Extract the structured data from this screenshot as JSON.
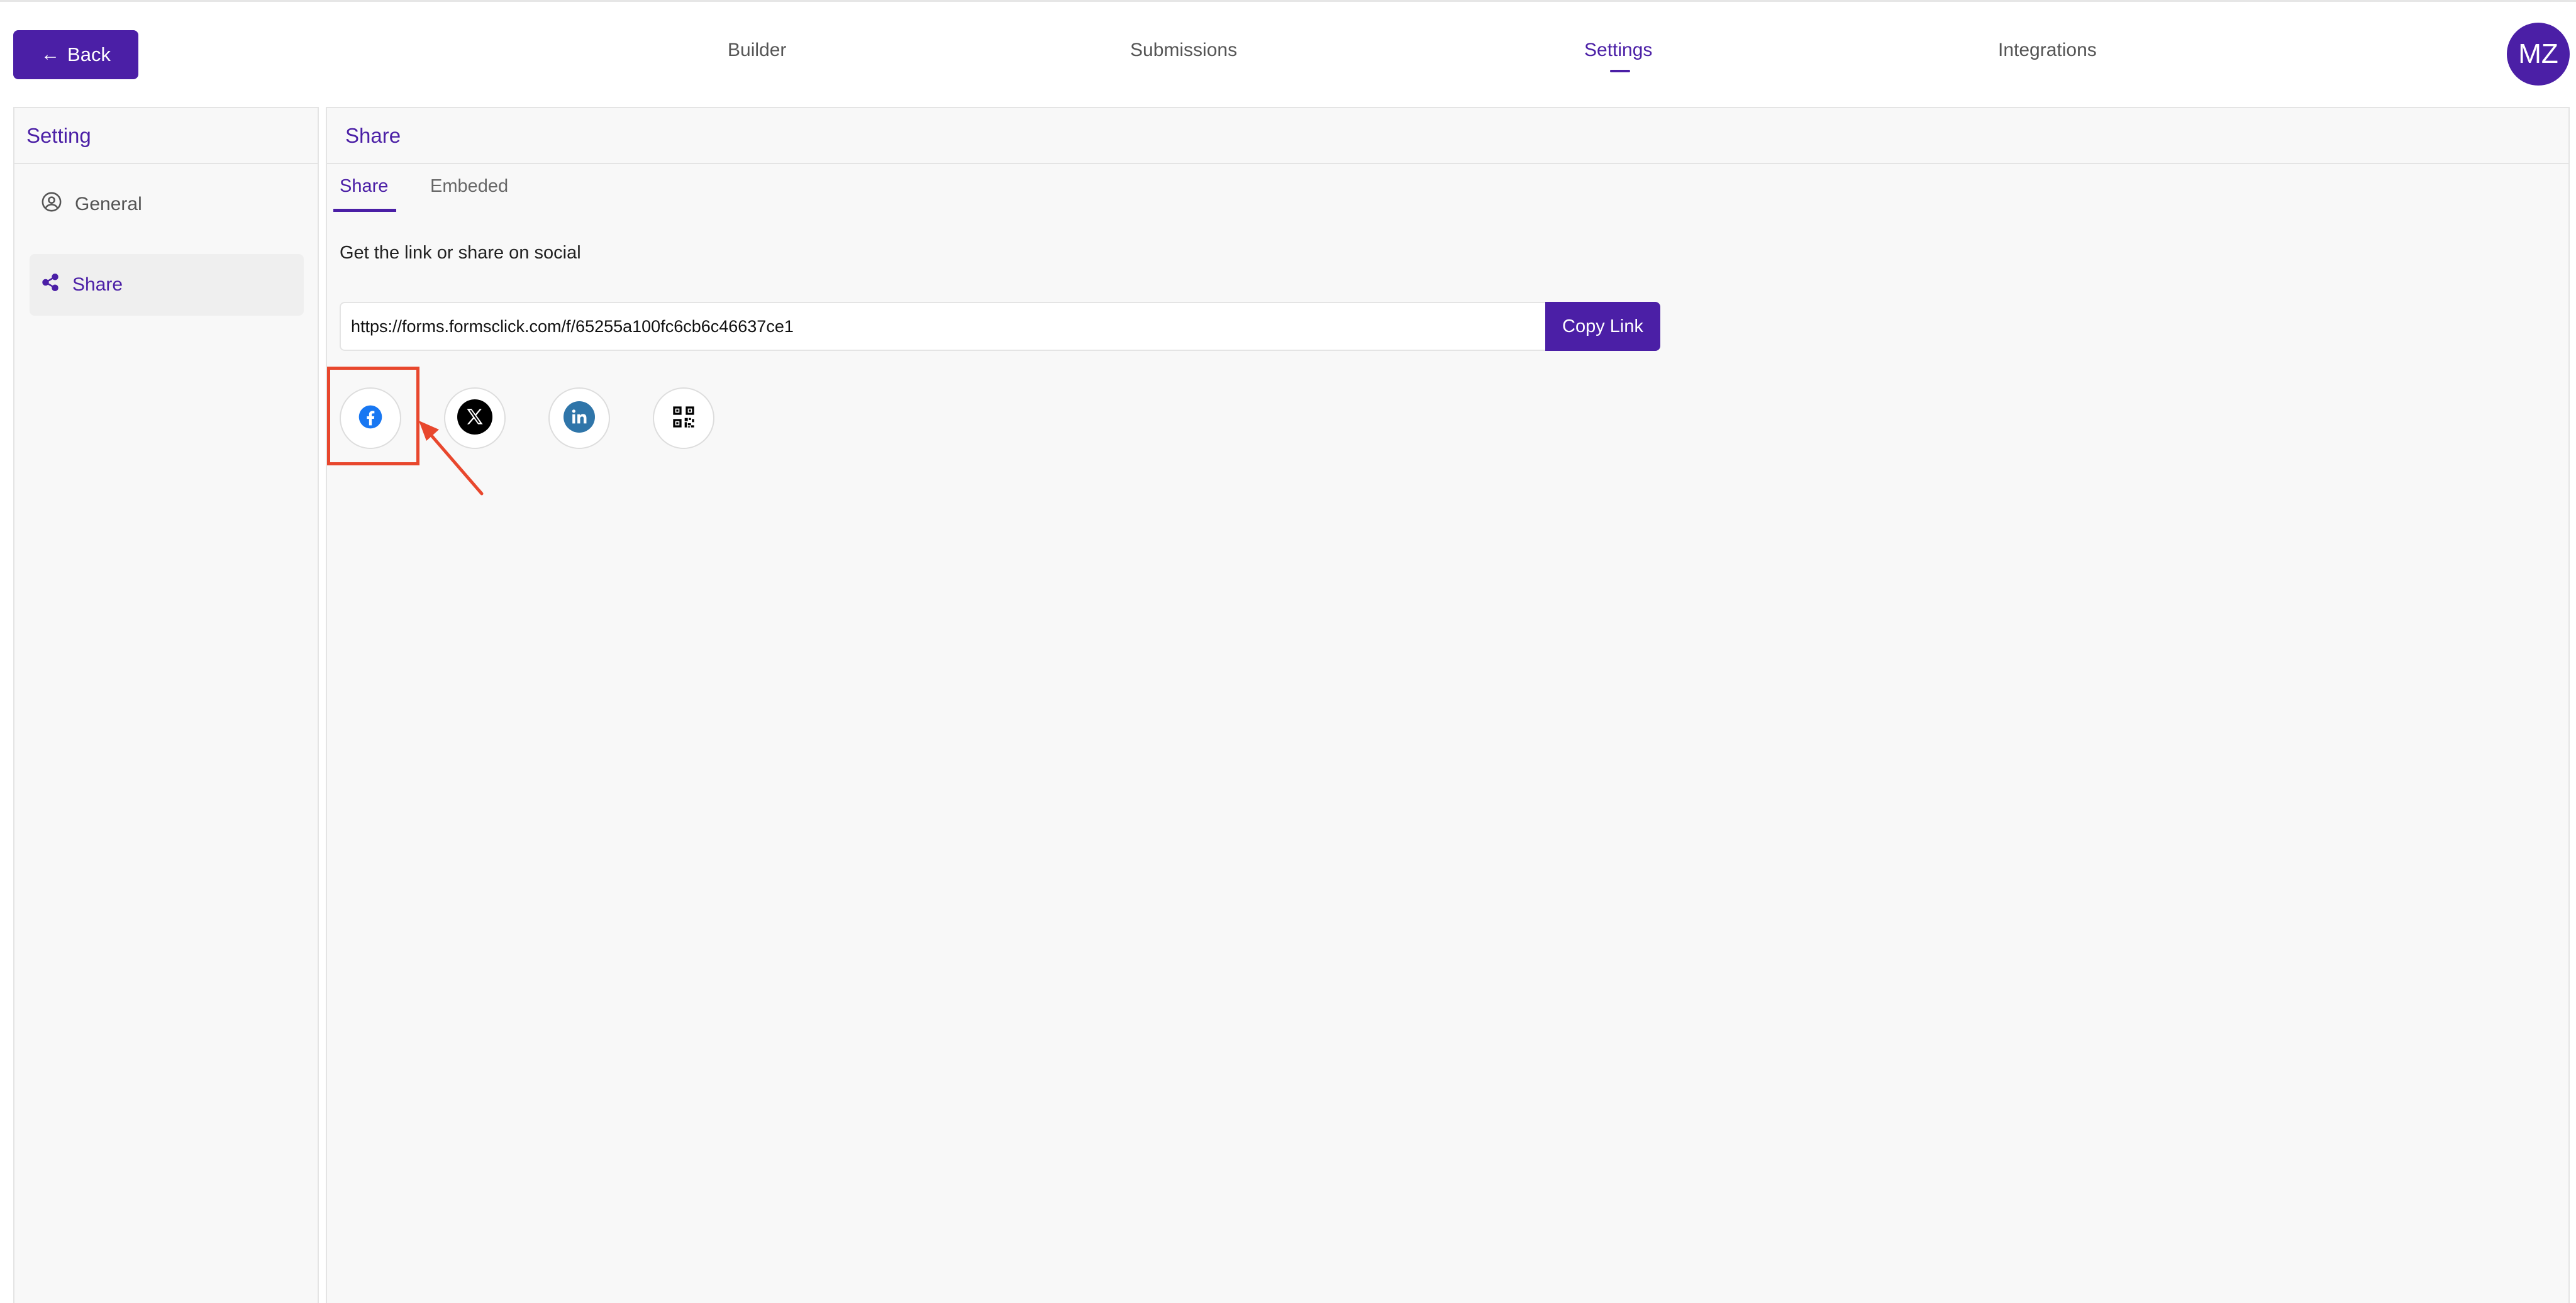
{
  "header": {
    "back_label": "Back",
    "tabs": [
      {
        "label": "Builder",
        "active": false
      },
      {
        "label": "Submissions",
        "active": false
      },
      {
        "label": "Settings",
        "active": true
      },
      {
        "label": "Integrations",
        "active": false
      }
    ],
    "avatar_initials": "MZ"
  },
  "sidebar": {
    "title": "Setting",
    "items": [
      {
        "label": "General",
        "icon": "user-circle-icon",
        "active": false
      },
      {
        "label": "Share",
        "icon": "share-icon",
        "active": true
      }
    ]
  },
  "main": {
    "title": "Share",
    "tabs": [
      {
        "label": "Share",
        "active": true
      },
      {
        "label": "Embeded",
        "active": false
      }
    ],
    "description": "Get the link or share on social",
    "share_link": "https://forms.formsclick.com/f/65255a100fc6cb6c46637ce1",
    "copy_label": "Copy Link",
    "social_buttons": [
      "facebook-icon",
      "x-icon",
      "linkedin-icon",
      "qr-code-icon"
    ]
  },
  "colors": {
    "accent": "#4b1fa6",
    "annotation": "#e8472d",
    "facebook": "#1877f2",
    "linkedin": "#2f75a9"
  }
}
